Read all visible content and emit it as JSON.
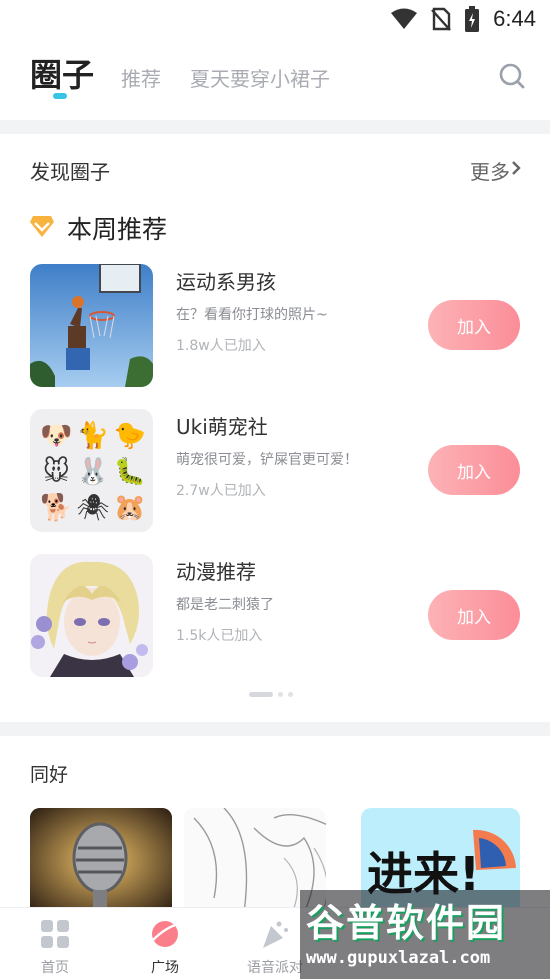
{
  "status_bar": {
    "time": "6:44"
  },
  "header": {
    "active_tab": "圈子",
    "tabs": [
      "推荐",
      "夏天要穿小裙子"
    ]
  },
  "discover": {
    "title": "发现圈子",
    "more": "更多",
    "weekly_title": "本周推荐",
    "join_label": "加入",
    "items": [
      {
        "name": "运动系男孩",
        "desc": "在？看看你打球的照片~",
        "count": "1.8w人已加入"
      },
      {
        "name": "Uki萌宠社",
        "desc": "萌宠很可爱，铲屎官更可爱！",
        "count": "2.7w人已加入"
      },
      {
        "name": "动漫推荐",
        "desc": "都是老二刺猿了",
        "count": "1.5k人已加入"
      }
    ],
    "pet_emojis": [
      "🐶",
      "🐈",
      "🐤",
      "🐭",
      "🐰",
      "🐛",
      "🐕",
      "🕷",
      "🐹"
    ]
  },
  "fans": {
    "title": "同好",
    "tile3_text": "进来!"
  },
  "bottom_nav": {
    "items": [
      {
        "label": "首页"
      },
      {
        "label": "广场"
      },
      {
        "label": "语音派对"
      }
    ]
  },
  "watermark": {
    "main": "谷普软件园",
    "url": "www.gupuxlazal.com"
  },
  "colors": {
    "accent": "#35c5e6",
    "join_gradient_start": "#fcb3b6",
    "join_gradient_end": "#fb8d98"
  }
}
